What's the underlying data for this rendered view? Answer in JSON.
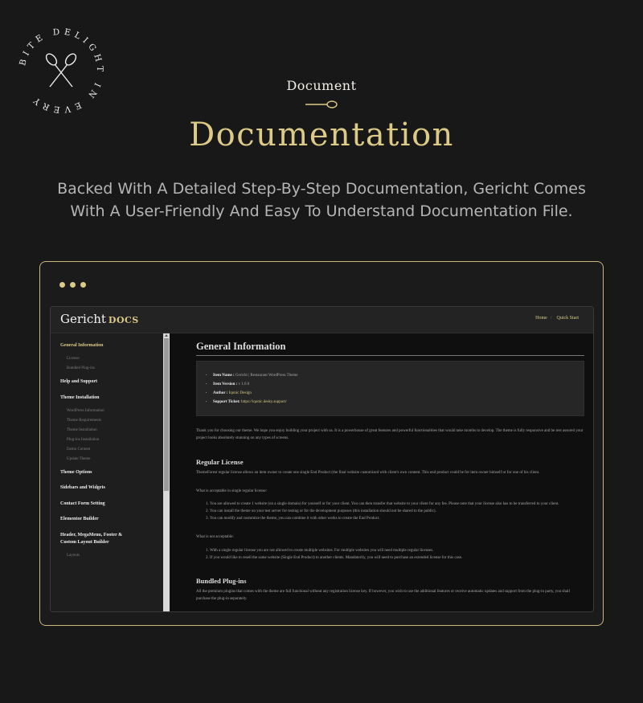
{
  "badge": {
    "text": "BITE DELIGHT IN EVERY"
  },
  "hero": {
    "eyebrow": "Document",
    "title": "Documentation",
    "lead": "Backed With A Detailed Step-By-Step Documentation, Gericht Comes With A User-Friendly And Easy To Understand Documentation File."
  },
  "colors": {
    "accent": "#dcca87",
    "background": "#181818",
    "panel": "#1e1e1e"
  },
  "window": {
    "logo": "Gericht",
    "logo_suffix": "DOCS",
    "topnav": [
      "Home",
      "Quick Start"
    ],
    "topnav_sep": "/"
  },
  "sidebar": {
    "sections": [
      {
        "label": "General Information",
        "active": true,
        "children": [
          "License",
          "Bundled Plug-ins"
        ]
      },
      {
        "label": "Help and Support",
        "children": []
      },
      {
        "label": "Theme Installation",
        "children": [
          "WordPress Information",
          "Theme Requirements",
          "Theme Installation",
          "Plug-ins Installation",
          "Demo Content",
          "Update Theme"
        ]
      },
      {
        "label": "Theme Options",
        "children": []
      },
      {
        "label": "Sidebars and Widgets",
        "children": []
      },
      {
        "label": "Contact Form Setting",
        "children": []
      },
      {
        "label": "Elementor Builder",
        "children": []
      },
      {
        "label": "Header, MegaMenu, Footer & Custom Layout Builder",
        "children": [
          "Layouts"
        ]
      }
    ]
  },
  "content": {
    "title": "General Information",
    "info": [
      {
        "label": "Item Name :",
        "value": "Gericht | Restaurant WordPress Theme",
        "gold": false
      },
      {
        "label": "Item Version :",
        "value": "v 1.0.0",
        "gold": false
      },
      {
        "label": "Author :",
        "value": "Iqonic Design",
        "gold": true
      },
      {
        "label": "Support Ticket:",
        "value": "https://iqonic.desky.support/",
        "gold": true
      }
    ],
    "intro": "Thank you for choosing our theme. We hope you enjoy building your project with us. It is a powerhouse of great features and powerful functionalities that would take months to develop. The theme is fully responsive and be rest assured your project looks absolutely stunning on any types of screens.",
    "license_title": "Regular License",
    "license_text": "ThemeForest regular license allows an item owner to create one single End Product (the final website customized with client's own content. This end product could be for item owner himself or for one of his client.",
    "acceptable_title": "What is acceptable in single regular license:",
    "acceptable": [
      "You are allowed to create 1 website (on a single domain) for yourself or for your client. You can then transfer that website to your client for any fee. Please note that your license also has to be transferred to your client.",
      "You can install the theme on your test server for testing or for the development purposes (this installation should not be shared to the public).",
      "You can modify and customize the theme, you can combine it with other works to create the End Product."
    ],
    "not_acceptable_title": "What is not acceptable:",
    "not_acceptable": [
      "With a single regular license you are not allowed to create multiple websites. For multiple websites you will need multiple regular licenses.",
      "If you would like to resell the same website (Single End Product) to another clients. Mandatorily, you will need to purchase an extended license for this case."
    ],
    "plugins_title": "Bundled Plug-ins",
    "plugins_text": "All the premium plugins that comes with the theme are full functional without any registration license key. If however, you wish to use the additional features or receive automatic updates and support from the plug-in party, you shall purchase the plug-in separately."
  }
}
